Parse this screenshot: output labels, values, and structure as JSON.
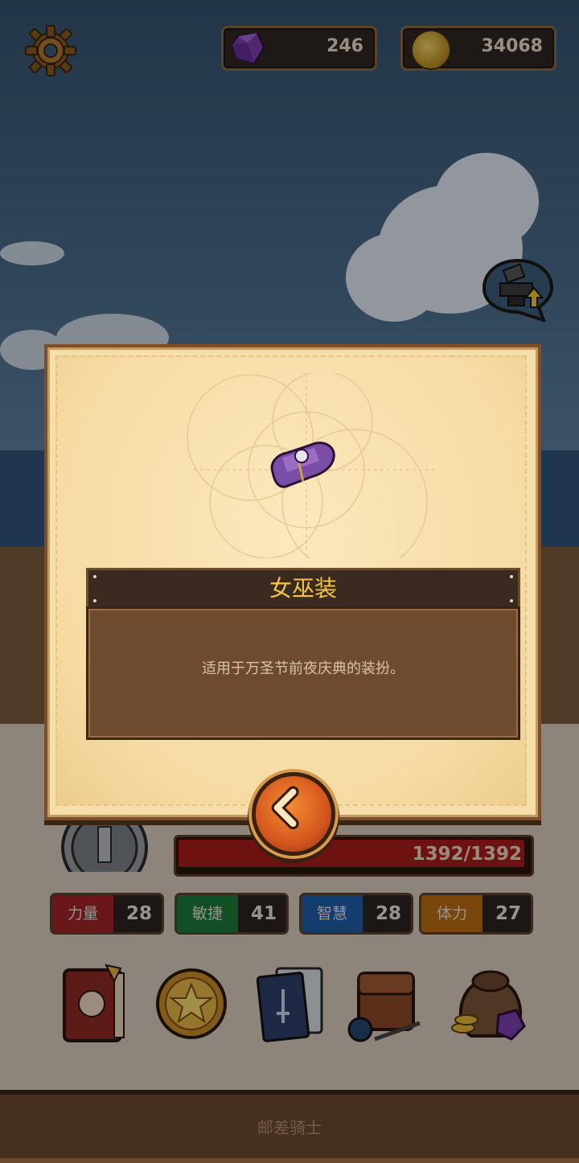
{
  "currency": {
    "gems": {
      "icon": "purple-gem-icon",
      "value": "246"
    },
    "gold": {
      "icon": "gold-coin-icon",
      "value": "34068"
    }
  },
  "header": {
    "settings_icon": "gear-icon"
  },
  "side_buttons": {
    "anvil_upgrade_icon": "anvil-upgrade-icon"
  },
  "item_modal": {
    "item_icon": "witch-costume-icon",
    "item_name": "女巫装",
    "item_description": "适用于万圣节前夜庆典的装扮。",
    "back_icon": "chevron-left-icon"
  },
  "character": {
    "hp_text": "1392/1392",
    "hp_fraction": 1.0,
    "stats": [
      {
        "label": "力量",
        "value": "28",
        "color": "#a3242b"
      },
      {
        "label": "敏捷",
        "value": "41",
        "color": "#1e7a3a"
      },
      {
        "label": "智慧",
        "value": "28",
        "color": "#1f5fa8"
      },
      {
        "label": "体力",
        "value": "27",
        "color": "#b86a12"
      }
    ]
  },
  "bottom_menu": [
    {
      "icon": "journal-book-icon"
    },
    {
      "icon": "star-coin-icon"
    },
    {
      "icon": "card-deck-icon"
    },
    {
      "icon": "inventory-bag-icon"
    },
    {
      "icon": "treasure-sack-icon"
    }
  ],
  "footer": {
    "title": "邮差骑士"
  },
  "colors": {
    "accent_gold": "#f4c544",
    "panel_parchment": "#f6deaa",
    "panel_brown": "#6e4a2e",
    "hp_red": "#a81d1b"
  }
}
